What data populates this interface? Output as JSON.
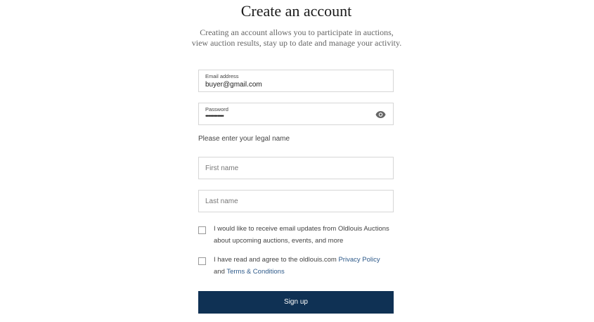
{
  "page": {
    "title": "Create an account",
    "subtitle": "Creating an account allows you to participate in auctions, view auction results, stay up to date and manage your activity."
  },
  "form": {
    "email": {
      "label": "Email address",
      "value": "buyer@gmail.com"
    },
    "password": {
      "label": "Password",
      "masked_value": "••••••••••••",
      "toggle_icon": "eye-icon"
    },
    "legal_name_prompt": "Please enter your legal name",
    "first_name": {
      "placeholder": "First name",
      "value": ""
    },
    "last_name": {
      "placeholder": "Last name",
      "value": ""
    },
    "email_updates": {
      "checked": false,
      "text": "I would like to receive email updates from Oldlouis Auctions about upcoming auctions, events, and more"
    },
    "terms": {
      "checked": false,
      "text_before": "I have read and agree to the oldlouis.com ",
      "privacy_link": "Privacy Policy",
      "text_middle": " and ",
      "terms_link": "Terms & Conditions"
    },
    "submit_label": "Sign up"
  },
  "colors": {
    "primary_button": "#0f3154",
    "link": "#2e5a8a",
    "border": "#d6d6d6"
  }
}
